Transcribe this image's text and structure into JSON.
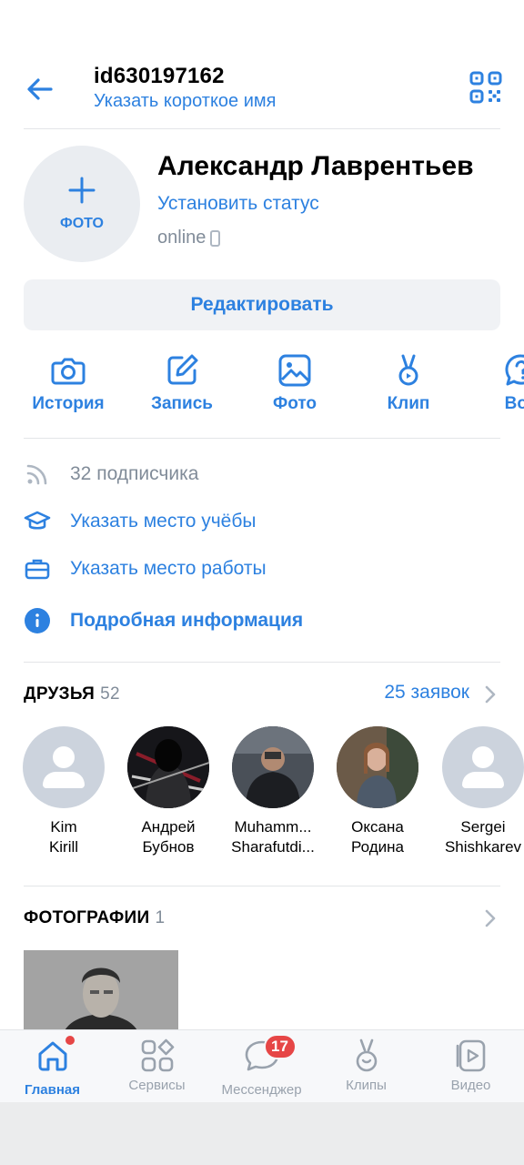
{
  "header": {
    "title": "id630197162",
    "subtitle": "Указать короткое имя"
  },
  "profile": {
    "photo_label": "ФОТО",
    "name": "Александр Лаврентьев",
    "status": "Установить статус",
    "online": "online",
    "edit_button": "Редактировать"
  },
  "actions": [
    {
      "label": "История",
      "icon": "camera-icon"
    },
    {
      "label": "Запись",
      "icon": "edit-icon"
    },
    {
      "label": "Фото",
      "icon": "image-icon"
    },
    {
      "label": "Клип",
      "icon": "clip-icon"
    },
    {
      "label": "Воп",
      "icon": "question-icon"
    }
  ],
  "info": {
    "followers": "32 подписчика",
    "education": "Указать место учёбы",
    "work": "Указать место работы",
    "details": "Подробная информация"
  },
  "friends": {
    "title": "ДРУЗЬЯ",
    "count": "52",
    "requests": "25 заявок",
    "items": [
      {
        "line1": "Kim",
        "line2": "Kirill"
      },
      {
        "line1": "Андрей",
        "line2": "Бубнов"
      },
      {
        "line1": "Muhamm...",
        "line2": "Sharafutdi..."
      },
      {
        "line1": "Оксана",
        "line2": "Родина"
      },
      {
        "line1": "Sergei",
        "line2": "Shishkarev"
      }
    ]
  },
  "photos": {
    "title": "ФОТОГРАФИИ",
    "count": "1"
  },
  "tabbar": {
    "items": [
      {
        "label": "Главная",
        "icon": "home-icon"
      },
      {
        "label": "Сервисы",
        "icon": "services-icon"
      },
      {
        "label": "Мессенджер",
        "icon": "messenger-icon"
      },
      {
        "label": "Клипы",
        "icon": "clips-icon"
      },
      {
        "label": "Видео",
        "icon": "video-icon"
      }
    ],
    "messenger_badge": "17"
  },
  "colors": {
    "accent": "#2d81e0",
    "secondary_text": "#818c99",
    "badge": "#e64646"
  }
}
